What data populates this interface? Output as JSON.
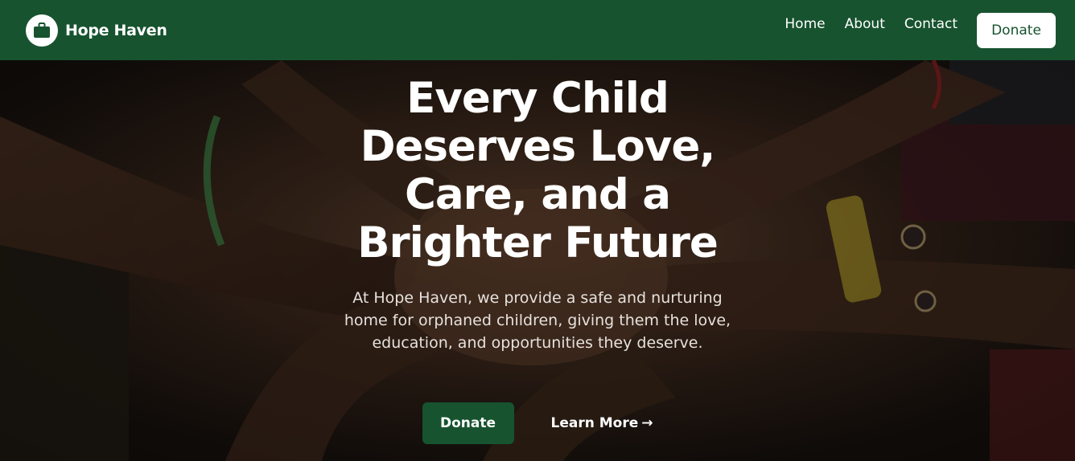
{
  "brand": {
    "name": "Hope Haven",
    "logo_icon": "briefcase-icon"
  },
  "nav": {
    "links": [
      "Home",
      "About",
      "Contact"
    ],
    "donate_label": "Donate"
  },
  "hero": {
    "title": "Every Child Deserves Love, Care, and a Brighter Future",
    "description": "At Hope Haven, we provide a safe and nurturing home for orphaned children, giving them the love, education, and opportunities they deserve.",
    "primary_button": "Donate",
    "secondary_button": "Learn More",
    "secondary_icon": "arrow-right-icon",
    "arrow_glyph": "→"
  },
  "colors": {
    "brand_green": "#17532f",
    "white": "#ffffff"
  }
}
